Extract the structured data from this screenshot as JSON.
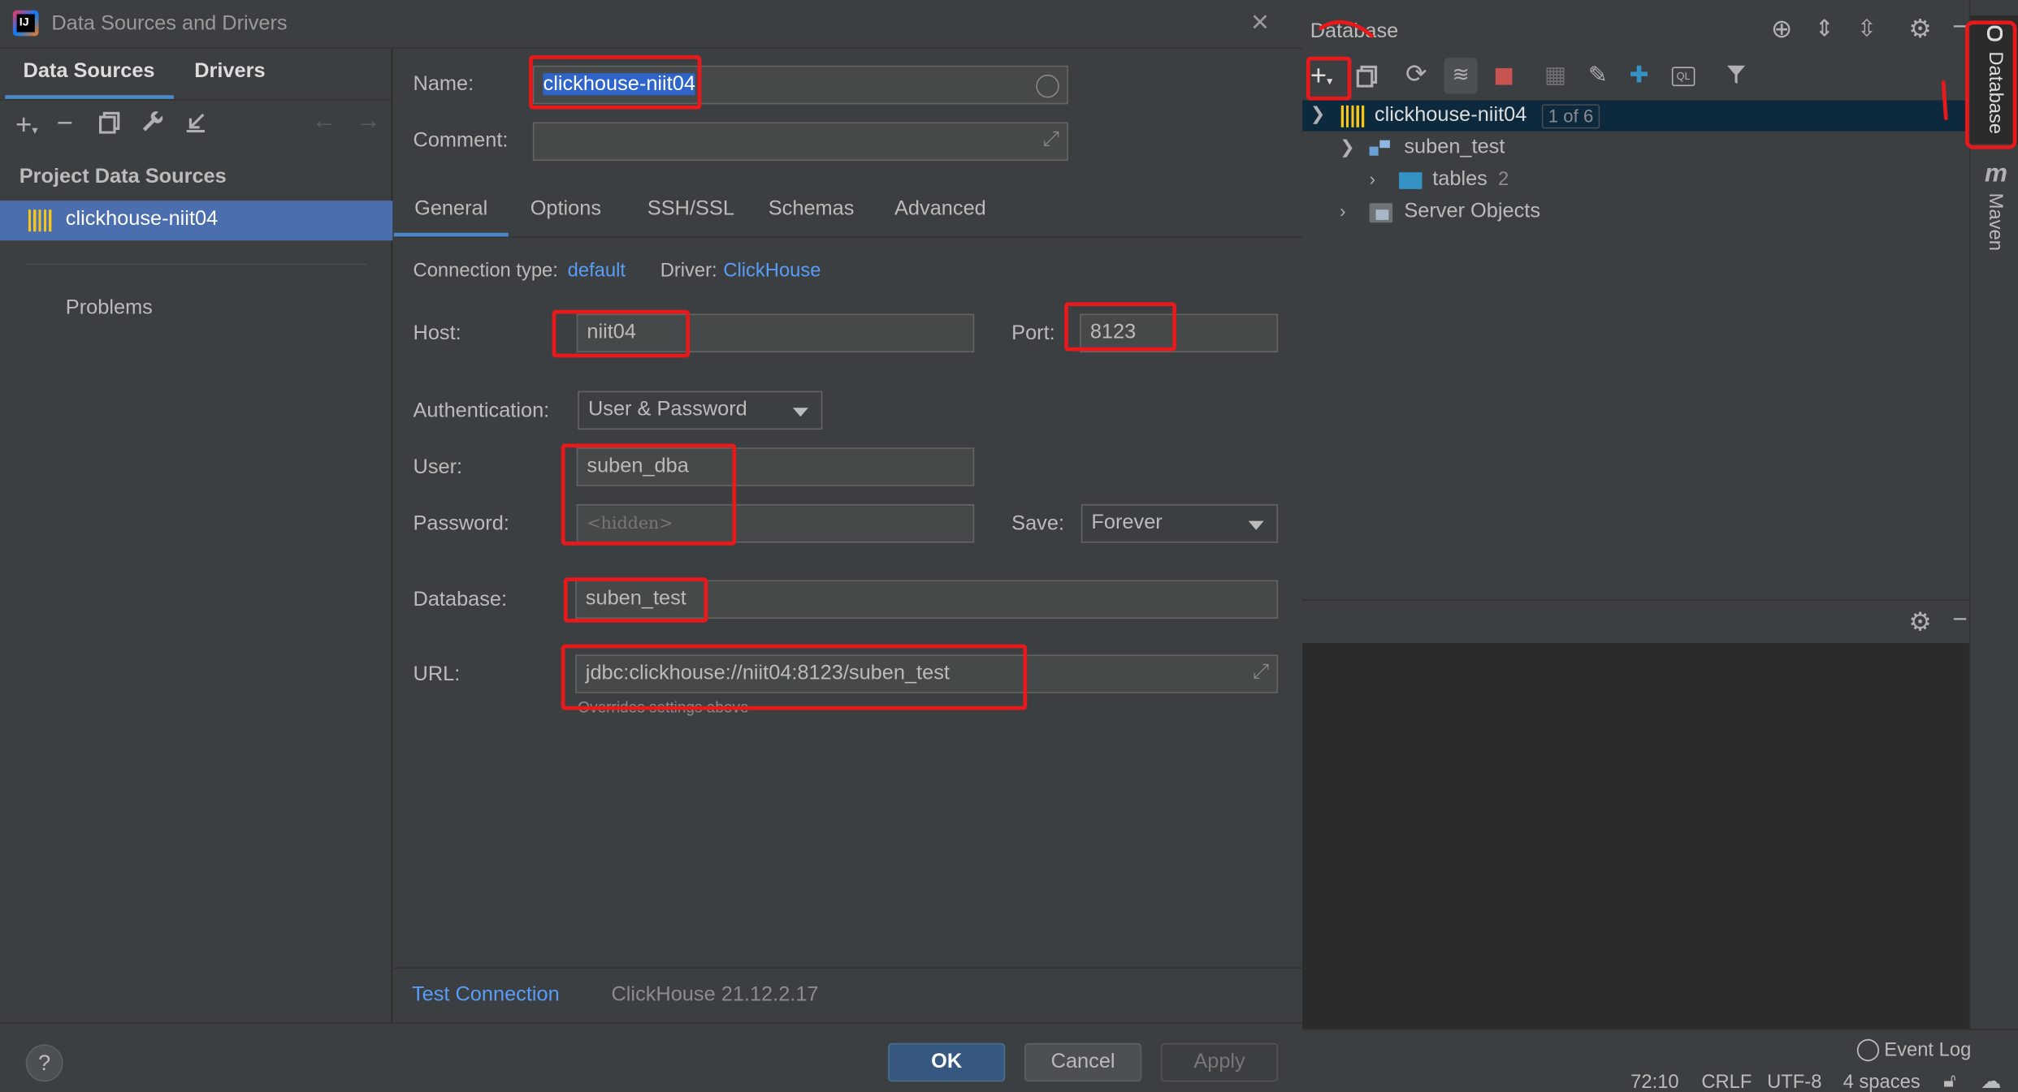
{
  "dialog": {
    "title": "Data Sources and Drivers",
    "close_label": "×",
    "left": {
      "tabs": [
        "Data Sources",
        "Drivers"
      ],
      "section_title": "Project Data Sources",
      "selected_source": "clickhouse-niit04",
      "problems_label": "Problems"
    },
    "form": {
      "name_label": "Name:",
      "name_value": "clickhouse-niit04",
      "comment_label": "Comment:",
      "comment_value": "",
      "tabs": [
        "General",
        "Options",
        "SSH/SSL",
        "Schemas",
        "Advanced"
      ],
      "connection_type_label": "Connection type:",
      "connection_type_value": "default",
      "driver_label": "Driver:",
      "driver_value": "ClickHouse",
      "host_label": "Host:",
      "host_value": "niit04",
      "port_label": "Port:",
      "port_value": "8123",
      "auth_label": "Authentication:",
      "auth_value": "User & Password",
      "user_label": "User:",
      "user_value": "suben_dba",
      "password_label": "Password:",
      "password_placeholder": "<hidden>",
      "save_label": "Save:",
      "save_value": "Forever",
      "database_label": "Database:",
      "database_value": "suben_test",
      "url_label": "URL:",
      "url_value": "jdbc:clickhouse://niit04:8123/suben_test",
      "url_hint": "Overrides settings above"
    },
    "test_connection_label": "Test Connection",
    "server_version": "ClickHouse 21.12.2.17",
    "help_label": "?",
    "buttons": {
      "ok": "OK",
      "cancel": "Cancel",
      "apply": "Apply"
    }
  },
  "db_window": {
    "title": "Database",
    "tree": {
      "root_label": "clickhouse-niit04",
      "root_badge": "1 of 6",
      "schema_label": "suben_test",
      "tables_label": "tables",
      "tables_count": "2",
      "server_objects_label": "Server Objects"
    }
  },
  "side_strip": {
    "database_tab": "Database",
    "maven_tab": "Maven",
    "maven_glyph": "m"
  },
  "status_bar": {
    "event_log": "Event Log",
    "position": "72:10",
    "line_sep": "CRLF",
    "encoding": "UTF-8",
    "indent": "4 spaces"
  },
  "colors": {
    "accent": "#589df6",
    "selection": "#4b6eaf",
    "highlight": "#e8191b",
    "ok_button": "#365880"
  }
}
